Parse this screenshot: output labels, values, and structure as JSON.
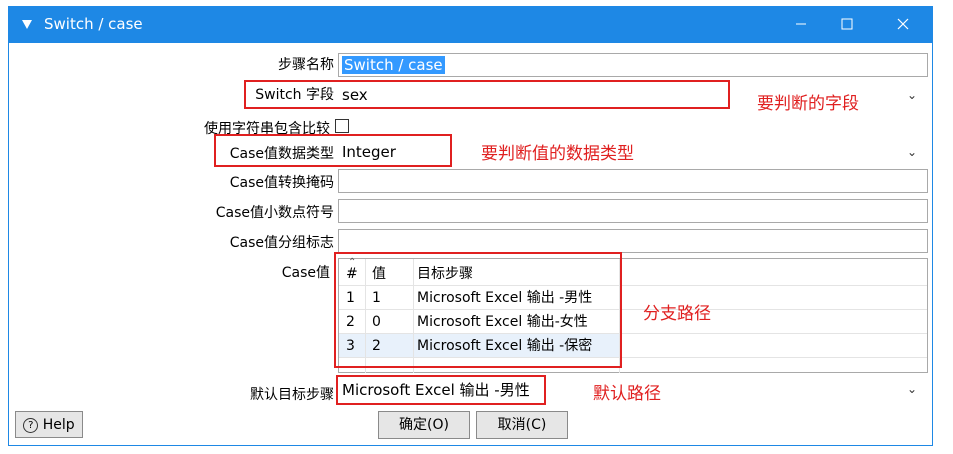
{
  "window": {
    "title": "Switch / case"
  },
  "fields": {
    "step_name_label": "步骤名称",
    "step_name_value": "Switch / case",
    "switch_field_label": "Switch 字段",
    "switch_field_value": "sex",
    "use_string_compare_label": "使用字符串包含比较",
    "case_type_label": "Case值数据类型",
    "case_type_value": "Integer",
    "case_mask_label": "Case值转换掩码",
    "case_decimal_label": "Case值小数点符号",
    "case_group_label": "Case值分组标志",
    "case_values_label": "Case值",
    "default_target_label": "默认目标步骤",
    "default_target_value": "Microsoft Excel 输出 -男性"
  },
  "table": {
    "headers": {
      "num": "#",
      "value": "值",
      "target": "目标步骤"
    },
    "rows": [
      {
        "num": "1",
        "value": "1",
        "target": "Microsoft Excel 输出 -男性"
      },
      {
        "num": "2",
        "value": "0",
        "target": "Microsoft Excel 输出-女性"
      },
      {
        "num": "3",
        "value": "2",
        "target": "Microsoft Excel 输出 -保密"
      }
    ]
  },
  "annotations": {
    "switch_field": "要判断的字段",
    "case_type": "要判断值的数据类型",
    "branch": "分支路径",
    "default": "默认路径"
  },
  "buttons": {
    "help": "Help",
    "ok": "确定(O)",
    "cancel": "取消(C)"
  },
  "colors": {
    "titlebar": "#1e88e5",
    "annotation": "#e02020",
    "selection": "#3399ff"
  }
}
